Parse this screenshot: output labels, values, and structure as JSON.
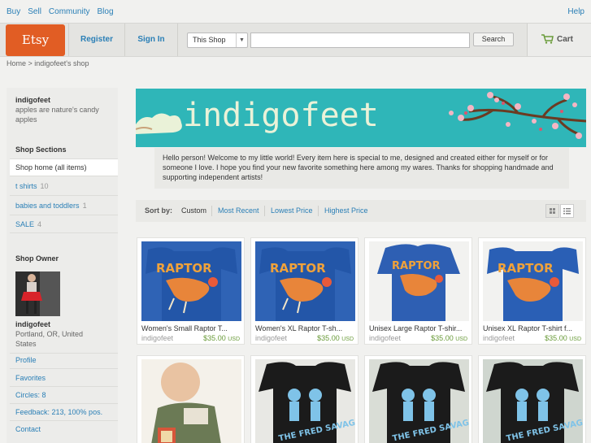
{
  "topnav": {
    "links": [
      "Buy",
      "Sell",
      "Community",
      "Blog"
    ],
    "help": "Help"
  },
  "header": {
    "logo": "Etsy",
    "register": "Register",
    "sign_in": "Sign In",
    "search_scope": "This Shop",
    "search_value": "",
    "search_button": "Search",
    "cart": "Cart"
  },
  "breadcrumb": "Home > indigofeet's shop",
  "sidebar": {
    "shop_name": "indigofeet",
    "tagline": "apples are nature's candy apples",
    "sections_title": "Shop Sections",
    "sections": [
      {
        "label": "Shop home (all items)",
        "count": ""
      },
      {
        "label": "t shirts",
        "count": "10"
      },
      {
        "label": "babies and toddlers",
        "count": "1"
      },
      {
        "label": "SALE",
        "count": "4"
      }
    ],
    "owner_title": "Shop Owner",
    "owner_name": "indigofeet",
    "owner_location": "Portland, OR, United States",
    "links": [
      "Profile",
      "Favorites",
      "Circles: 8",
      "Feedback: 213, 100% pos.",
      "Contact"
    ]
  },
  "banner": {
    "title": "indigofeet"
  },
  "welcome": "Hello person! Welcome to my little world! Every item here is special to me, designed and created either for myself or for someone I love. I hope you find your new favorite something here among my wares. Thanks for shopping handmade and supporting independent artists!",
  "sort": {
    "label": "Sort by:",
    "options": [
      "Custom",
      "Most Recent",
      "Lowest Price",
      "Highest Price"
    ]
  },
  "listings": [
    {
      "title": "Women's Small Raptor T...",
      "seller": "indigofeet",
      "price": "$35.00",
      "currency": "USD",
      "image": "raptor-shirt"
    },
    {
      "title": "Women's XL Raptor T-sh...",
      "seller": "indigofeet",
      "price": "$35.00",
      "currency": "USD",
      "image": "raptor-shirt"
    },
    {
      "title": "Unisex Large Raptor T-shir...",
      "seller": "indigofeet",
      "price": "$35.00",
      "currency": "USD",
      "image": "raptor-shirt-worn"
    },
    {
      "title": "Unisex XL Raptor T-shirt f...",
      "seller": "indigofeet",
      "price": "$35.00",
      "currency": "USD",
      "image": "raptor-shirt"
    },
    {
      "image": "baby-photo"
    },
    {
      "image": "fred-savages-shirt"
    },
    {
      "image": "fred-savages-shirt"
    },
    {
      "image": "fred-savages-shirt"
    }
  ],
  "colors": {
    "brand": "#e15d24",
    "link": "#2a7fb6",
    "banner": "#2fb6b8",
    "price": "#6a9b3a"
  }
}
